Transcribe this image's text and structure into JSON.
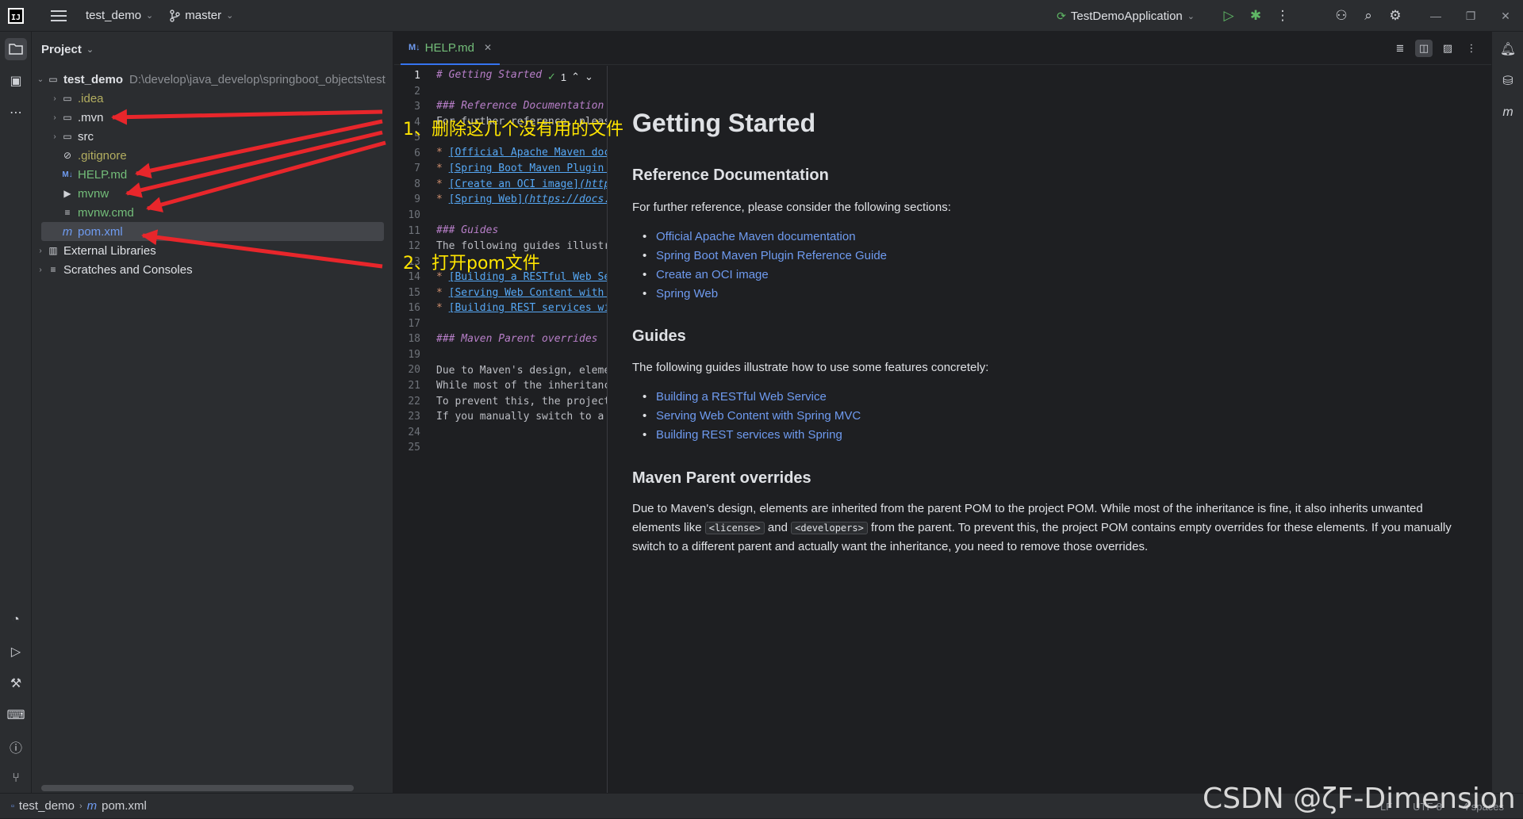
{
  "titlebar": {
    "logo": "IJ",
    "project": "test_demo",
    "branch": "master",
    "run_config": "TestDemoApplication"
  },
  "project_panel": {
    "title": "Project",
    "tree": [
      {
        "name": "test_demo",
        "path": "D:\\develop\\java_develop\\springboot_objects\\test",
        "icon": "folder-icon"
      },
      {
        "name": ".idea",
        "icon": "folder-icon"
      },
      {
        "name": ".mvn",
        "icon": "folder-icon"
      },
      {
        "name": "src",
        "icon": "folder-icon"
      },
      {
        "name": ".gitignore",
        "icon": "ignore-icon"
      },
      {
        "name": "HELP.md",
        "icon": "markdown-icon"
      },
      {
        "name": "mvnw",
        "icon": "script-icon"
      },
      {
        "name": "mvnw.cmd",
        "icon": "text-file-icon"
      },
      {
        "name": "pom.xml",
        "icon": "maven-icon"
      },
      {
        "name": "External Libraries",
        "icon": "library-icon"
      },
      {
        "name": "Scratches and Consoles",
        "icon": "scratch-icon"
      }
    ]
  },
  "editor": {
    "tab": {
      "label": "HELP.md",
      "badge": "M↓"
    },
    "inspections": "1",
    "line_numbers": [
      "1",
      "2",
      "3",
      "4",
      "5",
      "6",
      "7",
      "8",
      "9",
      "10",
      "11",
      "12",
      "13",
      "14",
      "15",
      "16",
      "17",
      "18",
      "19",
      "20",
      "21",
      "22",
      "23",
      "24",
      "25"
    ],
    "code": {
      "l1": "# Getting Started",
      "l3": "### Reference Documentation",
      "l4": "For further reference, please consider the following sections:",
      "l6_link": "[Official Apache Maven documentation]",
      "l7_link": "[Spring Boot Maven Plugin Reference Guide]",
      "l8_link": "[Create an OCI image]",
      "l8_url": "(https://docs.spring.io)",
      "l9_link": "[Spring Web]",
      "l9_url": "(https://docs.spring.io)",
      "l11": "### Guides",
      "l12": "The following guides illustrate how to use some features concretely:",
      "l14_link": "[Building a RESTful Web Service]",
      "l15_link": "[Serving Web Content with Spring MVC]",
      "l16_link": "[Building REST services with Spring]",
      "l18": "### Maven Parent overrides",
      "l20": "Due to Maven's design, elements are inherited from the parent POM to the project POM.",
      "l21": "While most of the inheritance is fine, it also inherits unwanted elements like `<license>` and `<developers>` from the parent.",
      "l22": "To prevent this, the project POM contains empty overrides for these elements.",
      "l23": "If you manually switch to a different parent and actually want the inheritance, you need to remove those overrides."
    }
  },
  "preview": {
    "h1": "Getting Started",
    "ref_heading": "Reference Documentation",
    "ref_intro": "For further reference, please consider the following sections:",
    "ref_links": [
      "Official Apache Maven documentation",
      "Spring Boot Maven Plugin Reference Guide",
      "Create an OCI image",
      "Spring Web"
    ],
    "guides_heading": "Guides",
    "guides_intro": "The following guides illustrate how to use some features concretely:",
    "guides_links": [
      "Building a RESTful Web Service",
      "Serving Web Content with Spring MVC",
      "Building REST services with Spring"
    ],
    "maven_heading": "Maven Parent overrides",
    "maven_p1": "Due to Maven's design, elements are inherited from the parent POM to the project POM. While most of the inheritance is fine, it also inherits unwanted elements like",
    "code_license": "<license>",
    "and_word": "and",
    "code_developers": "<developers>",
    "maven_p2": "from the parent. To prevent this, the project POM contains empty overrides for these elements. If you manually switch to a different parent and actually want the inheritance, you need to remove those overrides."
  },
  "statusbar": {
    "crumb_project": "test_demo",
    "crumb_file": "pom.xml",
    "line_sep": "LF",
    "encoding": "UTF-8",
    "indent": "4 spaces"
  },
  "annotations": {
    "delete_note": "1、删除这几个没有用的文件",
    "open_note": "2、打开pom文件",
    "arrow_color": "#e8262b",
    "text_color": "#ffe500"
  },
  "watermark": "CSDN @ζF-Dimension あ"
}
